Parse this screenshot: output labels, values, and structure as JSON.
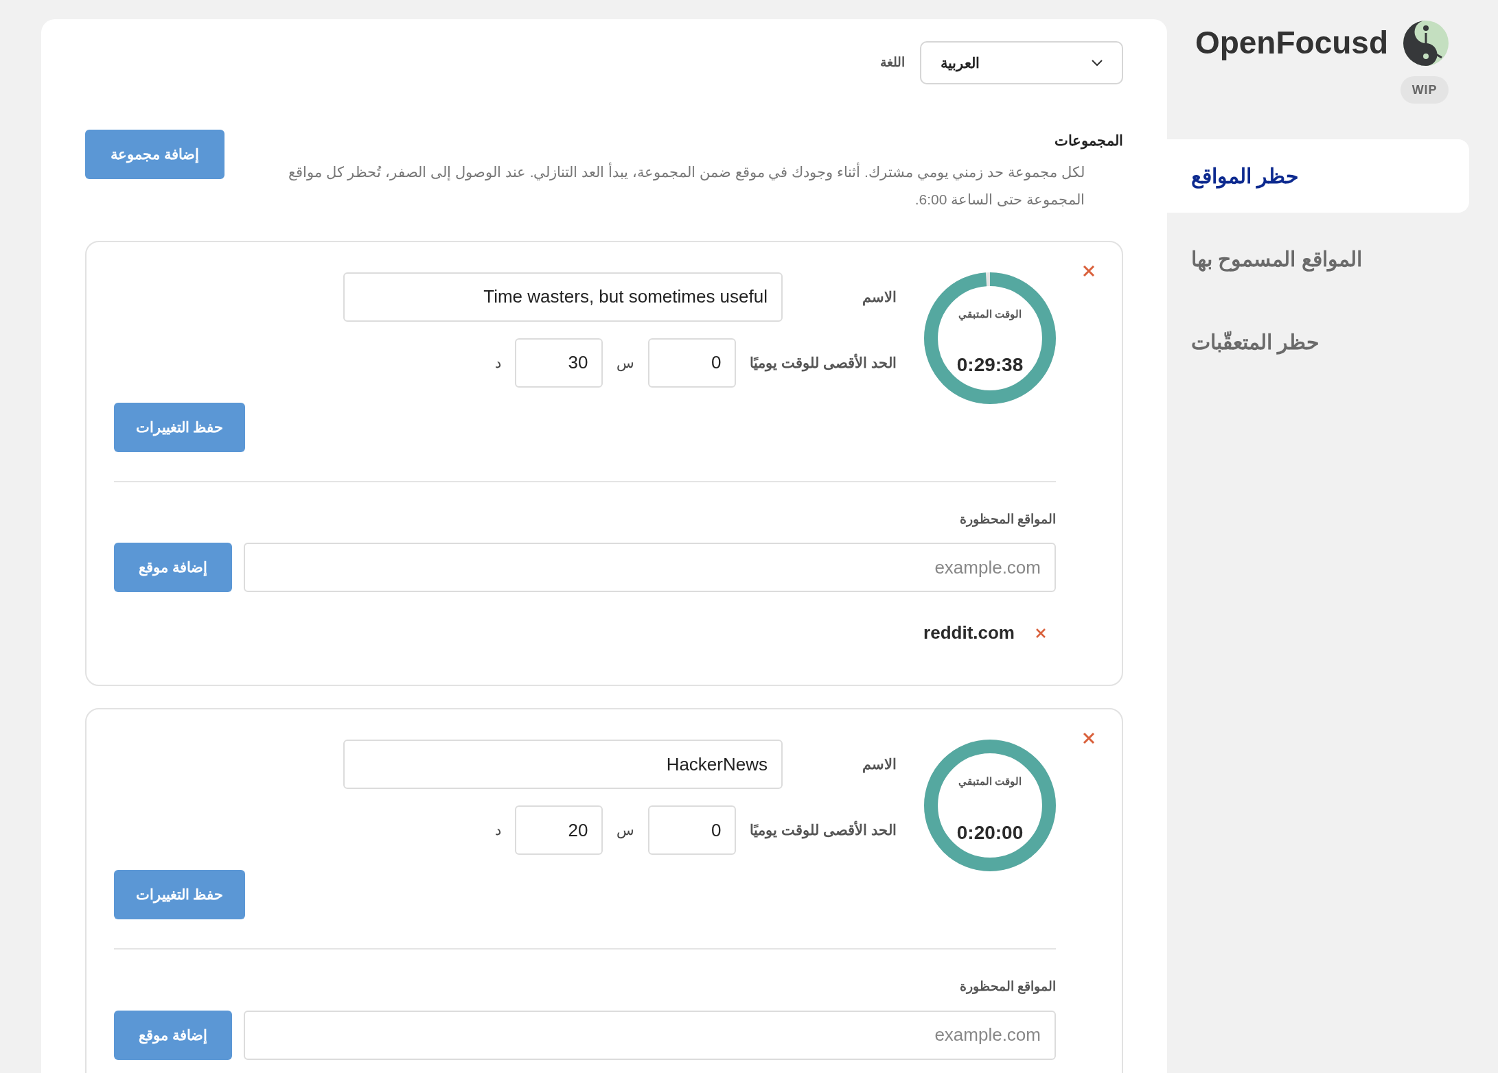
{
  "language": {
    "label": "اللغة",
    "value": "العربية"
  },
  "groups_section": {
    "heading": "المجموعات",
    "description": "لكل مجموعة حد زمني يومي مشترك. أثناء وجودك في موقع ضمن المجموعة، يبدأ العد التنازلي. عند الوصول إلى الصفر، تُحظر كل مواقع المجموعة حتى الساعة 6:00.",
    "add_button": "إضافة مجموعة"
  },
  "groups": [
    {
      "remaining_label": "الوقت المتبقي",
      "remaining": "0:29:38",
      "level": 0.988,
      "name_label": "الاسم",
      "name": "Time wasters, but sometimes useful",
      "limit_label": "الحد الأقصى للوقت يوميًا",
      "hours": "0",
      "hours_unit": "س",
      "minutes": "30",
      "minutes_unit": "د",
      "save_button": "حفظ التغييرات",
      "blocked_label": "المواقع المحظورة",
      "site_placeholder": "example.com",
      "add_site_button": "إضافة موقع",
      "sites": [
        {
          "domain": "reddit.com"
        }
      ]
    },
    {
      "remaining_label": "الوقت المتبقي",
      "remaining": "0:20:00",
      "level": 1,
      "name_label": "الاسم",
      "name": "HackerNews",
      "limit_label": "الحد الأقصى للوقت يوميًا",
      "hours": "0",
      "hours_unit": "س",
      "minutes": "20",
      "minutes_unit": "د",
      "save_button": "حفظ التغييرات",
      "blocked_label": "المواقع المحظورة",
      "site_placeholder": "example.com",
      "add_site_button": "إضافة موقع"
    }
  ],
  "brand": {
    "name": "OpenFocusd",
    "badge": "WIP"
  },
  "nav": [
    {
      "label": "حظر المواقع",
      "selected": true
    },
    {
      "label": "المواقع المسموح بها",
      "selected": false
    },
    {
      "label": "حظر المتعقّبات",
      "selected": false
    }
  ]
}
